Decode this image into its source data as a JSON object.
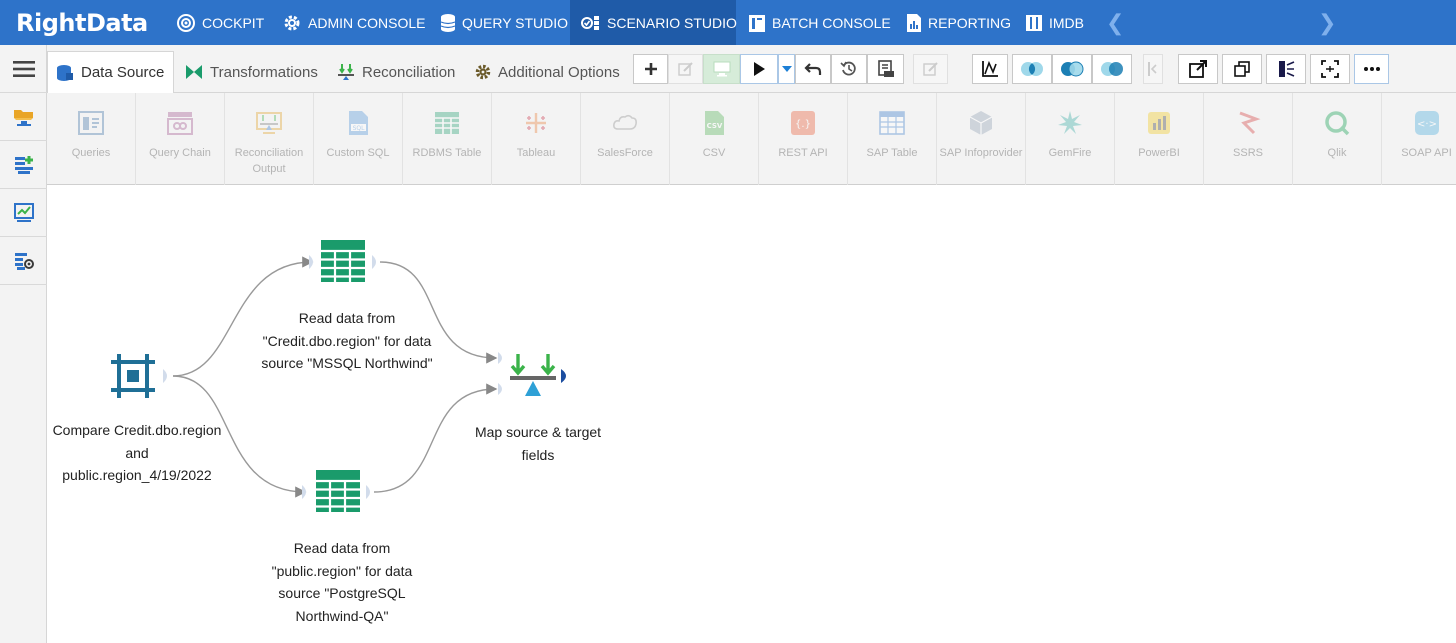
{
  "app": {
    "logo_text": "RightData"
  },
  "topnav": {
    "items": [
      {
        "label": "COCKPIT",
        "icon": "cockpit-gauge-icon"
      },
      {
        "label": "ADMIN CONSOLE",
        "icon": "gear-icon"
      },
      {
        "label": "QUERY STUDIO",
        "icon": "database-icon"
      },
      {
        "label": "SCENARIO STUDIO",
        "icon": "scenario-icon",
        "active": true
      },
      {
        "label": "BATCH CONSOLE",
        "icon": "batch-icon"
      },
      {
        "label": "REPORTING",
        "icon": "report-icon"
      },
      {
        "label": "IMDB",
        "icon": "imdb-icon"
      }
    ]
  },
  "tabs": [
    {
      "label": "Data Source",
      "icon": "database-tab-icon",
      "active": true
    },
    {
      "label": "Transformations",
      "icon": "bowtie-icon"
    },
    {
      "label": "Reconciliation",
      "icon": "reconciliation-icon"
    },
    {
      "label": "Additional Options",
      "icon": "cog-icon"
    }
  ],
  "palette": [
    {
      "label": "Queries"
    },
    {
      "label": "Query Chain"
    },
    {
      "label": "Reconciliation Output"
    },
    {
      "label": "Custom SQL"
    },
    {
      "label": "RDBMS Table"
    },
    {
      "label": "Tableau"
    },
    {
      "label": "SalesForce"
    },
    {
      "label": "CSV"
    },
    {
      "label": "REST API"
    },
    {
      "label": "SAP Table"
    },
    {
      "label": "SAP Infoprovider"
    },
    {
      "label": "GemFire"
    },
    {
      "label": "PowerBI"
    },
    {
      "label": "SSRS"
    },
    {
      "label": "Qlik"
    },
    {
      "label": "SOAP API"
    }
  ],
  "canvas": {
    "nodes": [
      {
        "id": "compare",
        "label": "Compare Credit.dbo.region and public.region_4/19/2022"
      },
      {
        "id": "read_mssql",
        "label": "Read data from \"Credit.dbo.region\" for data source \"MSSQL Northwind\""
      },
      {
        "id": "read_pg",
        "label": "Read data from \"public.region\" for data source \"PostgreSQL Northwind-QA\""
      },
      {
        "id": "map",
        "label": "Map source & target fields"
      }
    ]
  },
  "colors": {
    "nav_bg": "#2e73c9",
    "nav_active": "#1f5ba8",
    "table_green": "#1a9b6b",
    "compare_blue": "#1f6f96",
    "arrow_green": "#3bb34a",
    "accent_blue": "#1c7fd6"
  }
}
